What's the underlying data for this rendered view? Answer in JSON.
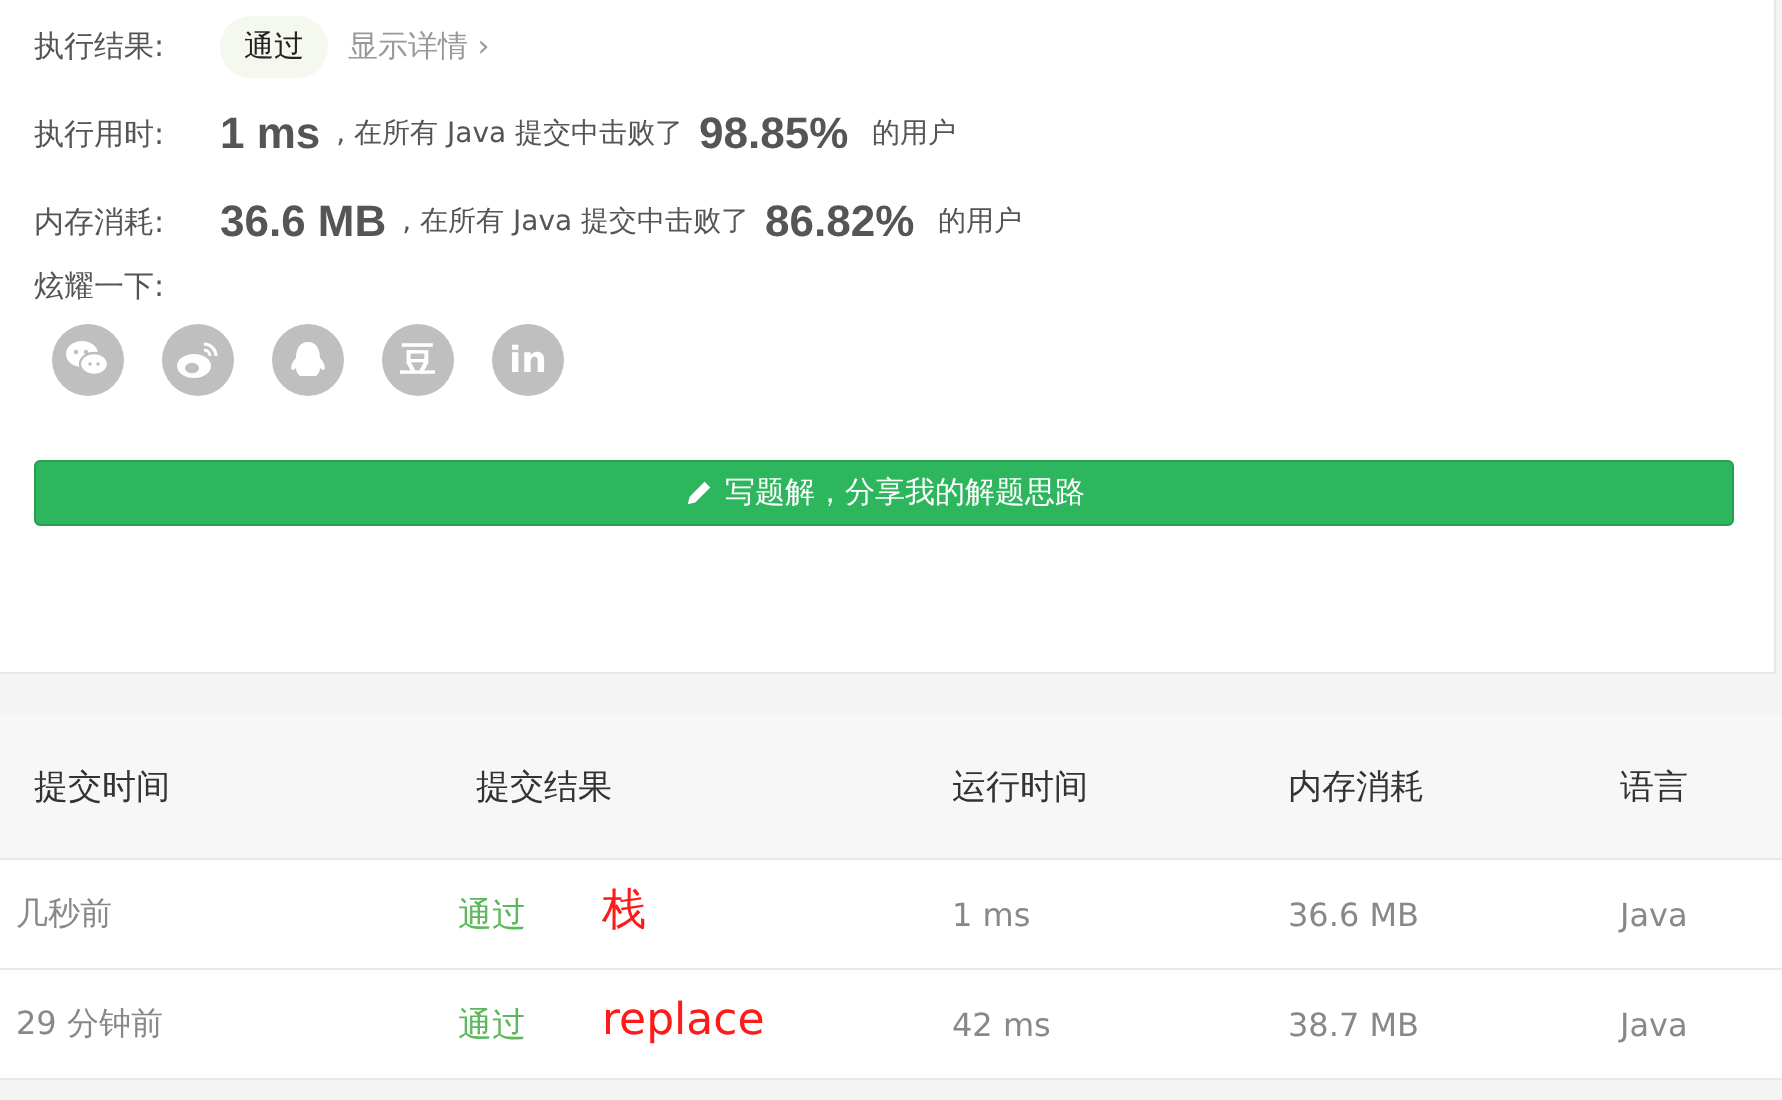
{
  "result": {
    "label": "执行结果:",
    "status": "通过",
    "details_link": "显示详情 ›"
  },
  "stats": [
    {
      "label": "执行用时:",
      "value": "1 ms",
      "middle": ", 在所有 Java 提交中击败了",
      "percent": "98.85%",
      "suffix": "的用户"
    },
    {
      "label": "内存消耗:",
      "value": "36.6 MB",
      "middle": ", 在所有 Java 提交中击败了",
      "percent": "86.82%",
      "suffix": "的用户"
    }
  ],
  "share": {
    "label": "炫耀一下:",
    "items": [
      {
        "kind": "chat"
      },
      {
        "kind": "weibo"
      },
      {
        "kind": "penguin"
      },
      {
        "kind": "glyph",
        "text": "豆"
      },
      {
        "kind": "glyph",
        "text": "in"
      }
    ]
  },
  "write_button": "写题解，分享我的解题思路",
  "table": {
    "columns": [
      "提交时间",
      "提交结果",
      "运行时间",
      "内存消耗",
      "语言"
    ],
    "rows": [
      {
        "time": "几秒前",
        "result": "通过",
        "note": "栈",
        "runtime": "1 ms",
        "memory": "36.6 MB",
        "language": "Java"
      },
      {
        "time": "29 分钟前",
        "result": "通过",
        "note": "replace",
        "runtime": "42 ms",
        "memory": "38.7 MB",
        "language": "Java"
      }
    ]
  }
}
